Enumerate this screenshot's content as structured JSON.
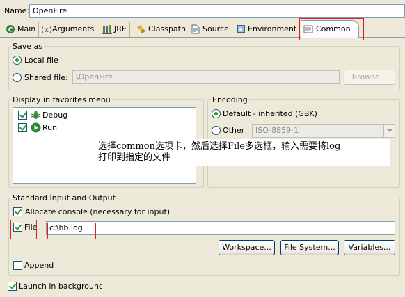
{
  "name_field": {
    "label": "Name:",
    "value": "OpenFire"
  },
  "tabs": [
    {
      "label": "Main",
      "icon": "main-tab-icon"
    },
    {
      "label": "Arguments",
      "icon": "arguments-icon"
    },
    {
      "label": "JRE",
      "icon": "jre-library-icon"
    },
    {
      "label": "Classpath",
      "icon": "classpath-icon"
    },
    {
      "label": "Source",
      "icon": "source-icon"
    },
    {
      "label": "Environment",
      "icon": "environment-icon"
    },
    {
      "label": "Common",
      "icon": "common-tab-icon",
      "selected": true
    }
  ],
  "save_as": {
    "title": "Save as",
    "local_file": "Local file",
    "shared_file": "Shared file:",
    "shared_path": "\\OpenFire",
    "browse": "Browse..."
  },
  "favorites": {
    "title": "Display in favorites menu",
    "items": [
      {
        "label": "Debug",
        "icon": "debug-bug-icon",
        "checked": true
      },
      {
        "label": "Run",
        "icon": "run-play-icon",
        "checked": true
      }
    ]
  },
  "encoding": {
    "title": "Encoding",
    "default_option": "Default - inherited (GBK)",
    "other_option": "Other",
    "other_value": "ISO-8859-1"
  },
  "annotation": {
    "line1": "选择common选项卡，然后选择File多选框，输入需要将log",
    "line2": "打印到指定的文件"
  },
  "std_io": {
    "title": "Standard Input and Output",
    "allocate_console": "Allocate console (necessary for input)",
    "file_label": "File",
    "file_value": "c:\\hb.log",
    "workspace_button": "Workspace...",
    "file_system_button": "File System...",
    "variables_button": "Variables...",
    "append": "Append"
  },
  "launch_background": "Launch in background",
  "colors": {
    "annotation_box": "#e31b1b",
    "check": "#21a121",
    "panel": "#ece9d8"
  }
}
